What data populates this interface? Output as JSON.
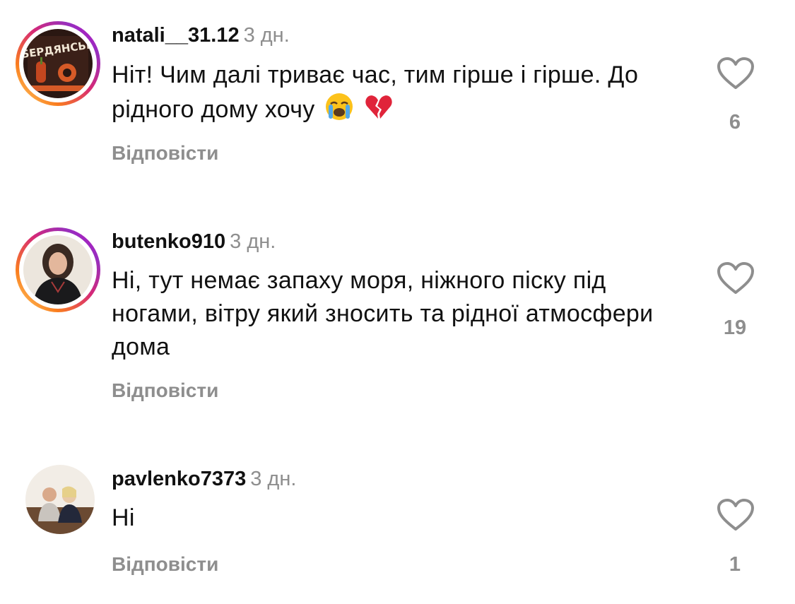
{
  "comments": [
    {
      "username": "natali__31.12",
      "time": "3 дн.",
      "text": "Ніт! Чим далі триває час, тим гірше і гірше. До рідного дому хочу",
      "emojis": [
        "loudly-crying-face",
        "broken-heart"
      ],
      "reply_label": "Відповісти",
      "likes": "6",
      "has_story_ring": true,
      "avatar_text": "БЕРДЯНСЬК"
    },
    {
      "username": "butenko910",
      "time": "3 дн.",
      "text": "Ні, тут немає запаху моря, ніжного піску під ногами, вітру який зносить та рідної атмосфери дома",
      "reply_label": "Відповісти",
      "likes": "19",
      "has_story_ring": true
    },
    {
      "username": "pavlenko7373",
      "time": "3 дн.",
      "text": "Ні",
      "reply_label": "Відповісти",
      "likes": "1",
      "has_story_ring": false
    }
  ],
  "icons": {
    "like": "heart-outline-icon"
  },
  "colors": {
    "secondary_text": "#8e8e8e",
    "primary_text": "#111111",
    "story_ring_start": "#feda75",
    "story_ring_end": "#d300c5"
  }
}
